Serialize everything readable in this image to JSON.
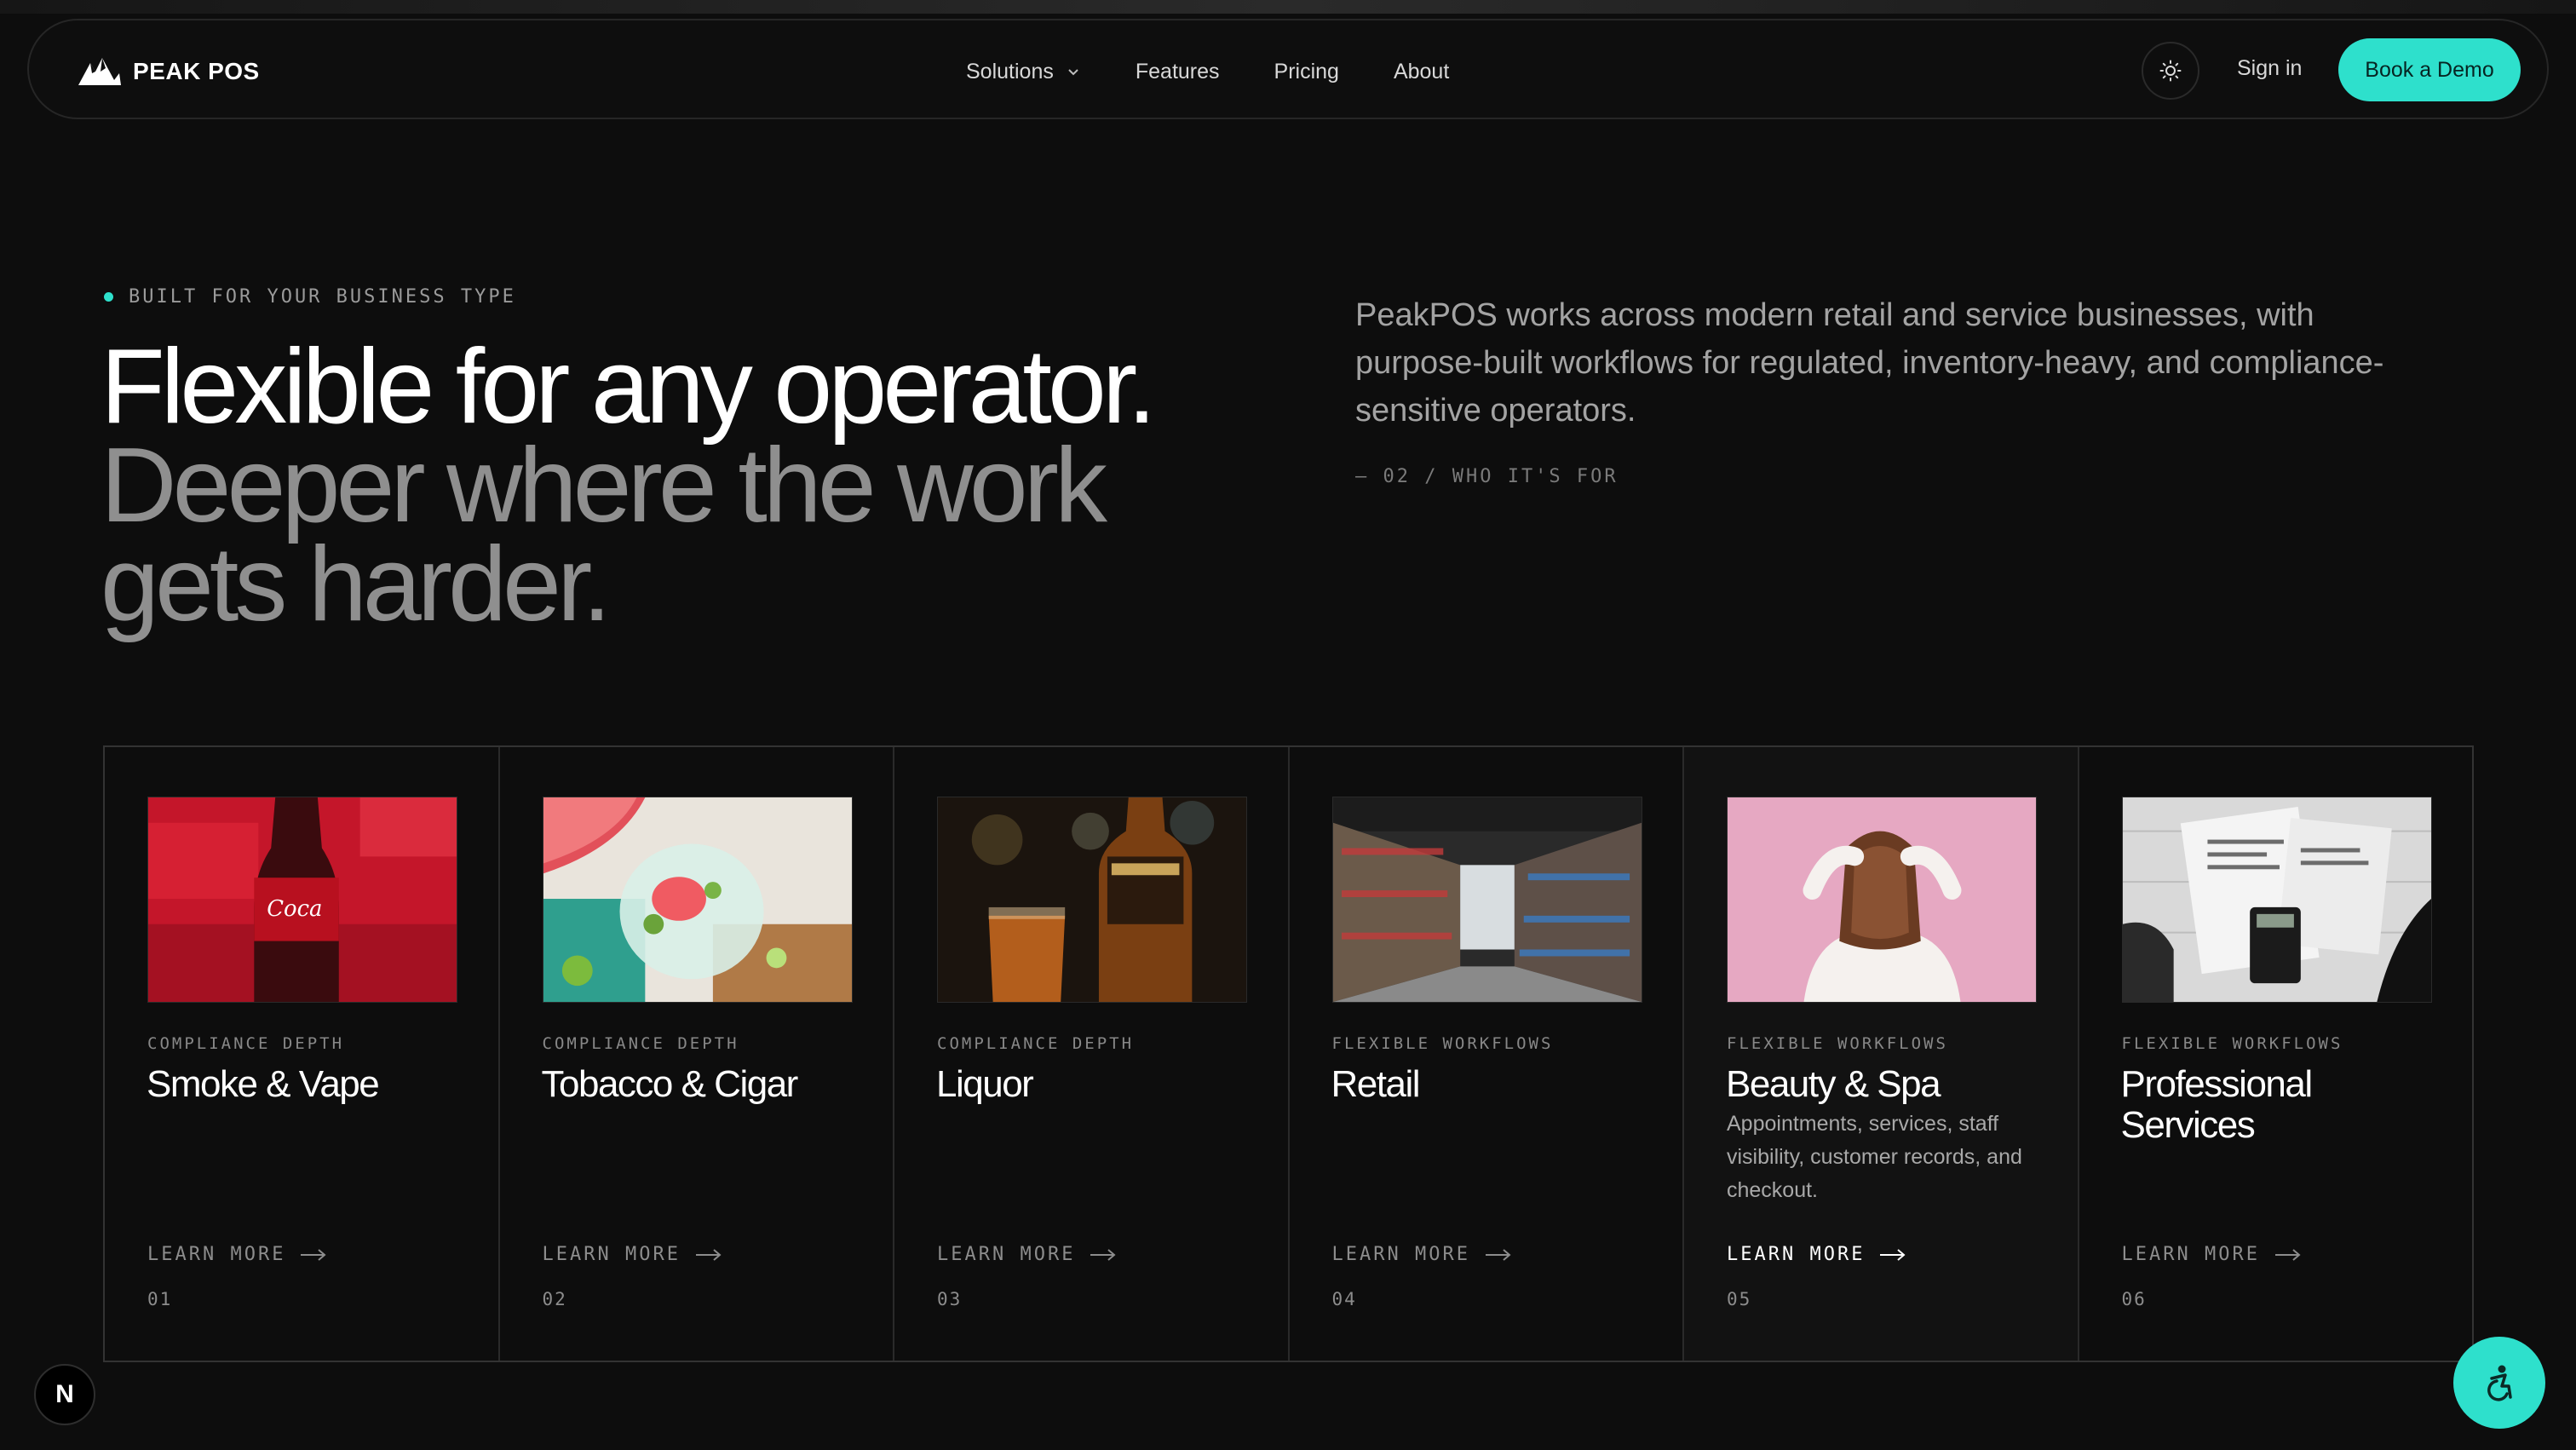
{
  "colors": {
    "accent": "#2ee0cc",
    "background": "#0d0d0d"
  },
  "nav": {
    "brand": "PEAK POS",
    "links": [
      {
        "label": "Solutions",
        "has_dropdown": true
      },
      {
        "label": "Features"
      },
      {
        "label": "Pricing"
      },
      {
        "label": "About"
      }
    ],
    "theme_icon": "sun-icon",
    "sign_in": "Sign in",
    "cta": "Book a Demo"
  },
  "hero": {
    "eyebrow": "BUILT FOR YOUR BUSINESS TYPE",
    "headline_line1": "Flexible for any operator.",
    "headline_line2": "Deeper where the work gets harder.",
    "intro": "PeakPOS works across modern retail and service businesses, with purpose-built workflows for regulated, inventory-heavy, and compliance-sensitive operators.",
    "section_tag": "— 02 / WHO IT'S FOR"
  },
  "cards": [
    {
      "category": "COMPLIANCE DEPTH",
      "title": "Smoke & Vape",
      "description": "",
      "learn_more": "LEARN MORE",
      "number": "01"
    },
    {
      "category": "COMPLIANCE DEPTH",
      "title": "Tobacco & Cigar",
      "description": "",
      "learn_more": "LEARN MORE",
      "number": "02"
    },
    {
      "category": "COMPLIANCE DEPTH",
      "title": "Liquor",
      "description": "",
      "learn_more": "LEARN MORE",
      "number": "03"
    },
    {
      "category": "FLEXIBLE WORKFLOWS",
      "title": "Retail",
      "description": "",
      "learn_more": "LEARN MORE",
      "number": "04"
    },
    {
      "category": "FLEXIBLE WORKFLOWS",
      "title": "Beauty & Spa",
      "description": "Appointments, services, staff visibility, customer records, and checkout.",
      "learn_more": "LEARN MORE",
      "number": "05",
      "active": true
    },
    {
      "category": "FLEXIBLE WORKFLOWS",
      "title": "Professional Services",
      "description": "",
      "learn_more": "LEARN MORE",
      "number": "06"
    }
  ],
  "floating": {
    "badge": "N",
    "accessibility_icon": "accessibility-icon"
  }
}
